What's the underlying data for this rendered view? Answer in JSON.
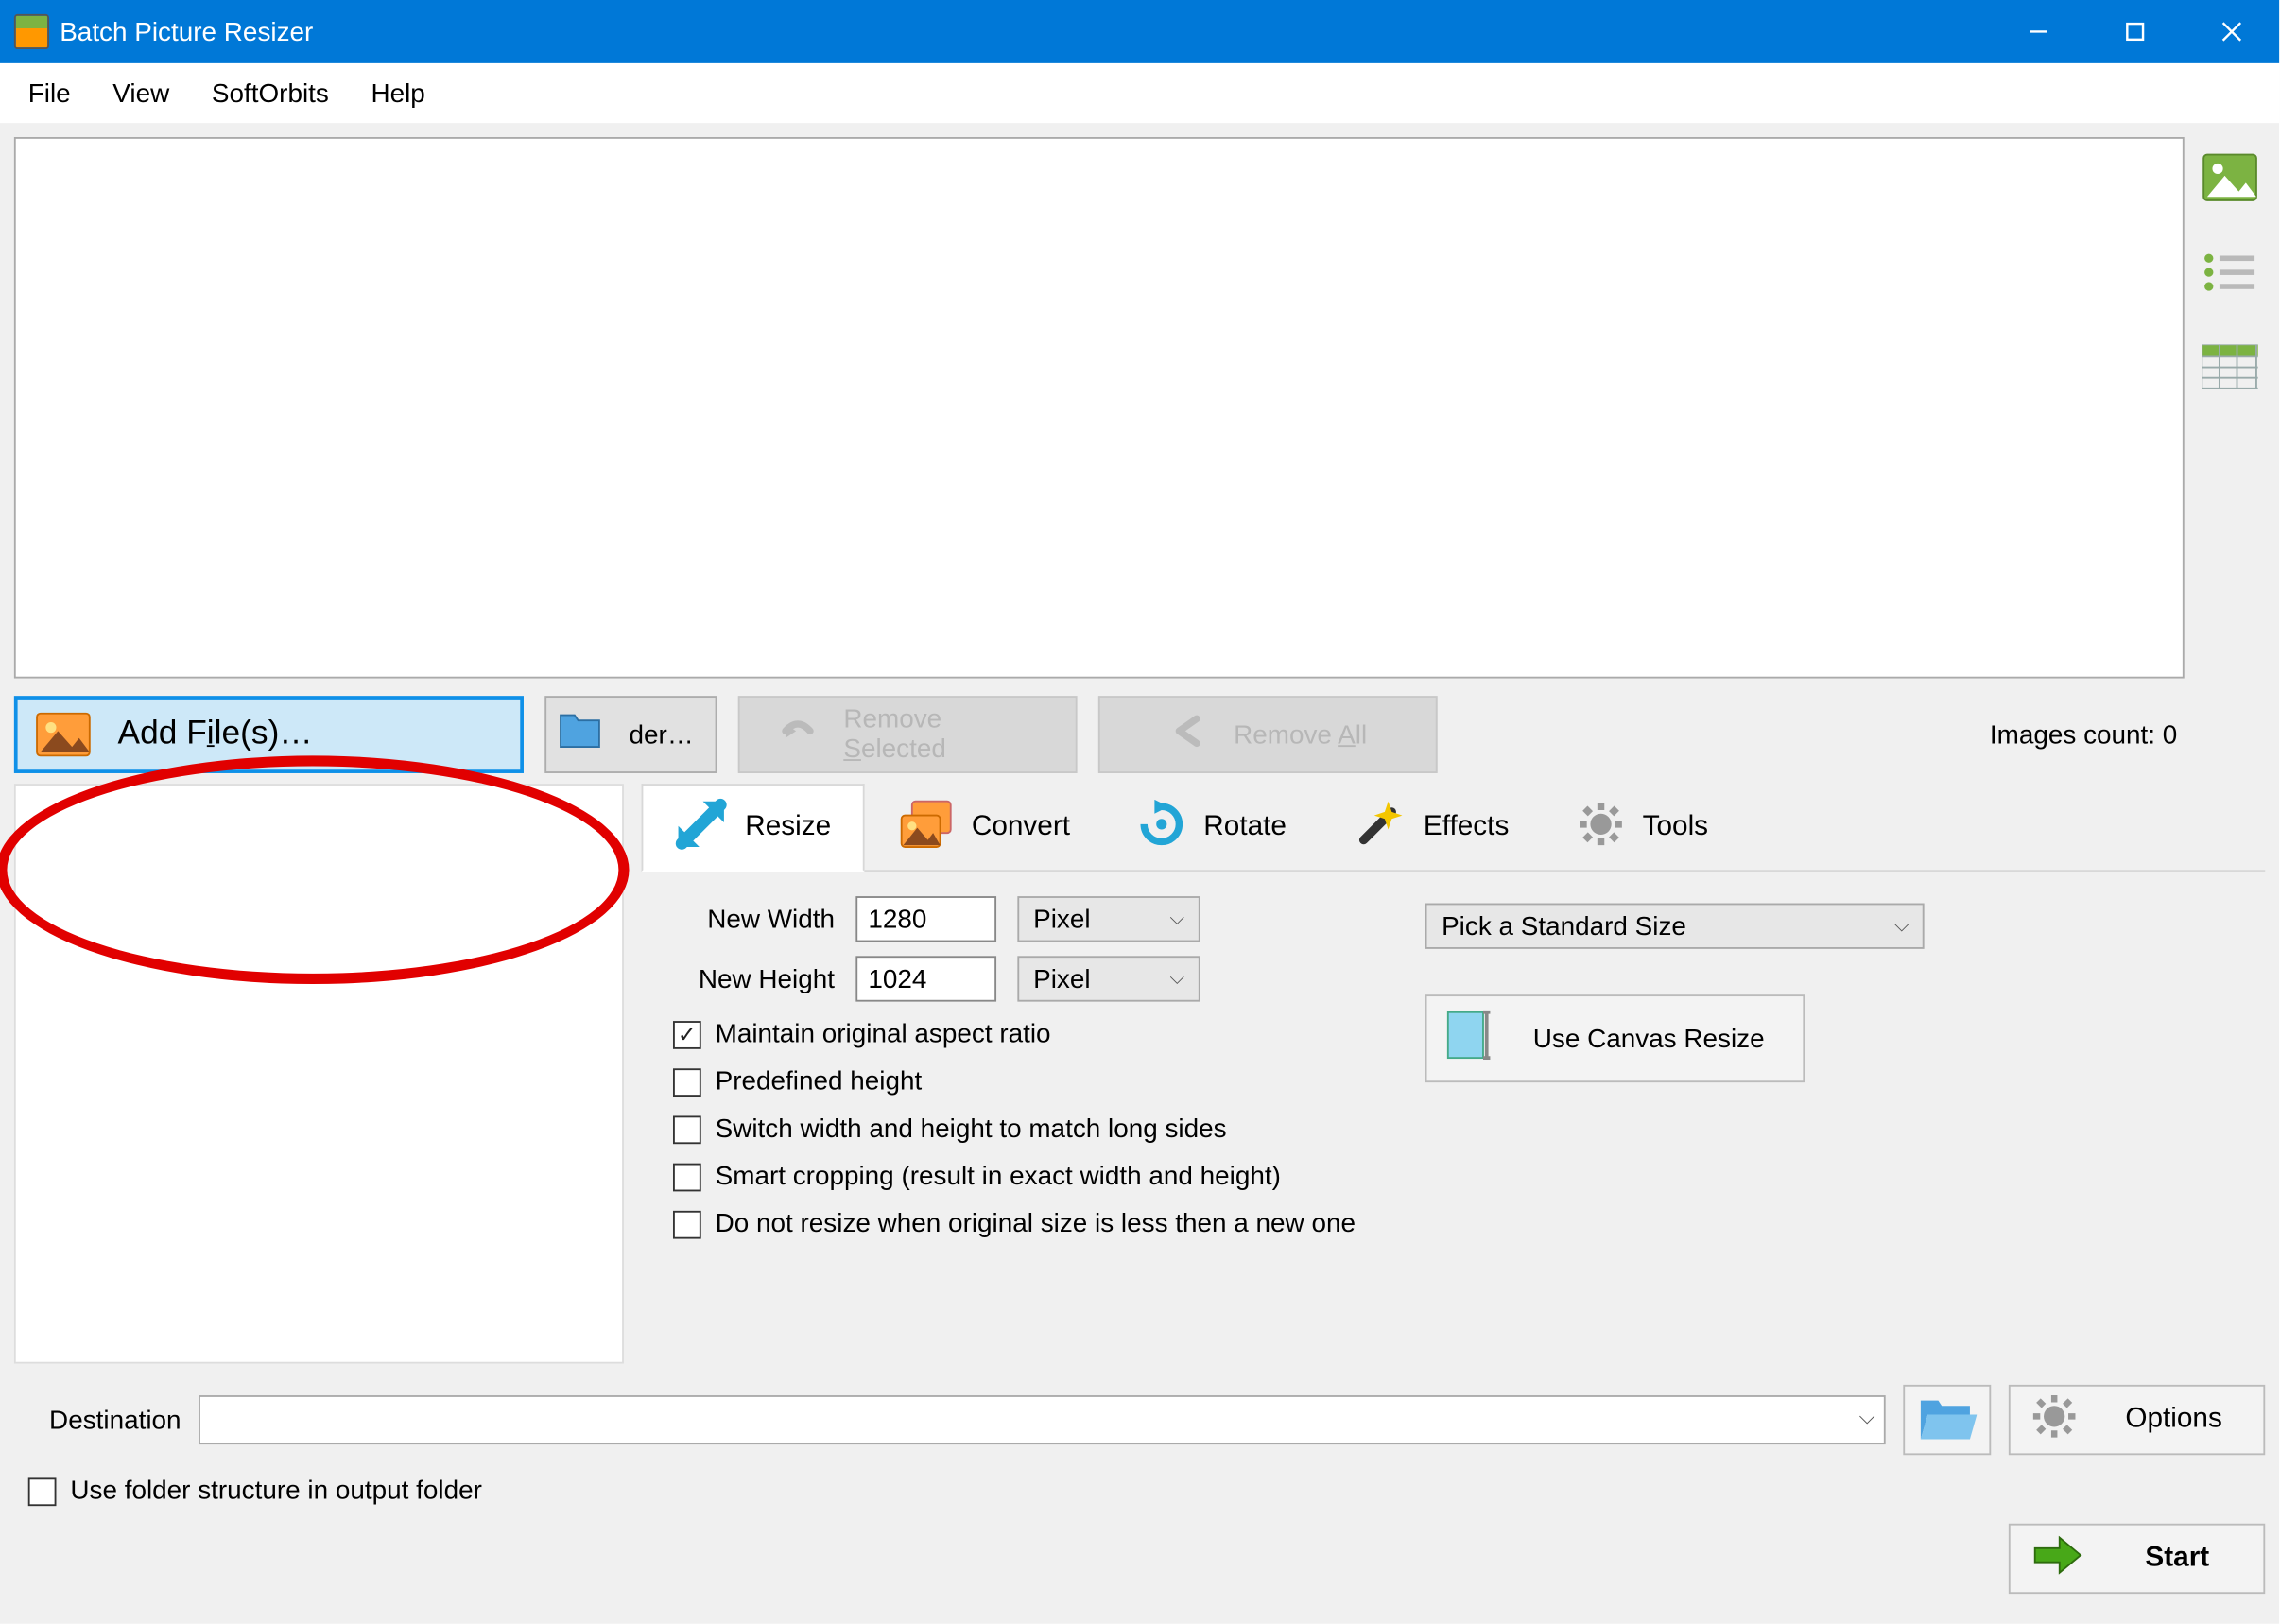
{
  "window": {
    "title": "Batch Picture Resizer"
  },
  "menus": {
    "file": "File",
    "view": "View",
    "softorbits": "SoftOrbits",
    "help": "Help"
  },
  "file_buttons": {
    "add_files": "Add File(s)…",
    "add_folder_fragment": "der…",
    "remove_selected_pre": "Remove ",
    "remove_selected_key": "S",
    "remove_selected_post": "elected",
    "remove_all_pre": "Remove ",
    "remove_all_key": "A",
    "remove_all_post": "ll"
  },
  "count_label": "Images count: 0",
  "tabs": {
    "resize": "Resize",
    "convert": "Convert",
    "rotate": "Rotate",
    "effects": "Effects",
    "tools": "Tools"
  },
  "resize": {
    "new_width_label": "New Width",
    "new_height_label": "New Height",
    "new_width_value": "1280",
    "new_height_value": "1024",
    "unit_width": "Pixel",
    "unit_height": "Pixel",
    "std_size": "Pick a Standard Size",
    "canvas_btn": "Use Canvas Resize",
    "cb_aspect": "Maintain original aspect ratio",
    "cb_predef": "Predefined height",
    "cb_switch": "Switch width and height to match long sides",
    "cb_smart": "Smart cropping (result in exact width and height)",
    "cb_noresize": "Do not resize when original size is less then a new one"
  },
  "dest": {
    "label": "Destination",
    "value": "",
    "folder_structure": "Use folder structure in output folder",
    "options": "Options",
    "start": "Start"
  }
}
